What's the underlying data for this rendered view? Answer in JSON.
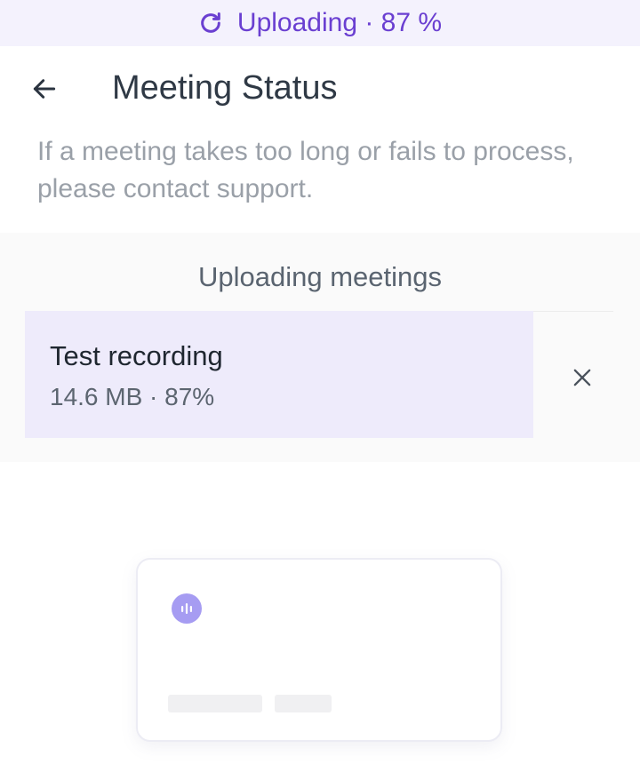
{
  "banner": {
    "icon": "refresh-icon",
    "text": "Uploading · 87 %",
    "color": "#6a3fd1",
    "background": "#f4f2fd"
  },
  "header": {
    "back_icon": "arrow-left-icon",
    "title": "Meeting Status"
  },
  "subtitle": "If a meeting takes too long or fails to process, please contact support.",
  "uploads_section": {
    "title": "Uploading meetings",
    "items": [
      {
        "name": "Test recording",
        "meta": "14.6 MB · 87%",
        "progress_percent": 87,
        "cancel_icon": "close-icon"
      }
    ]
  },
  "empty_state": {
    "icon": "audio-wave-icon"
  }
}
